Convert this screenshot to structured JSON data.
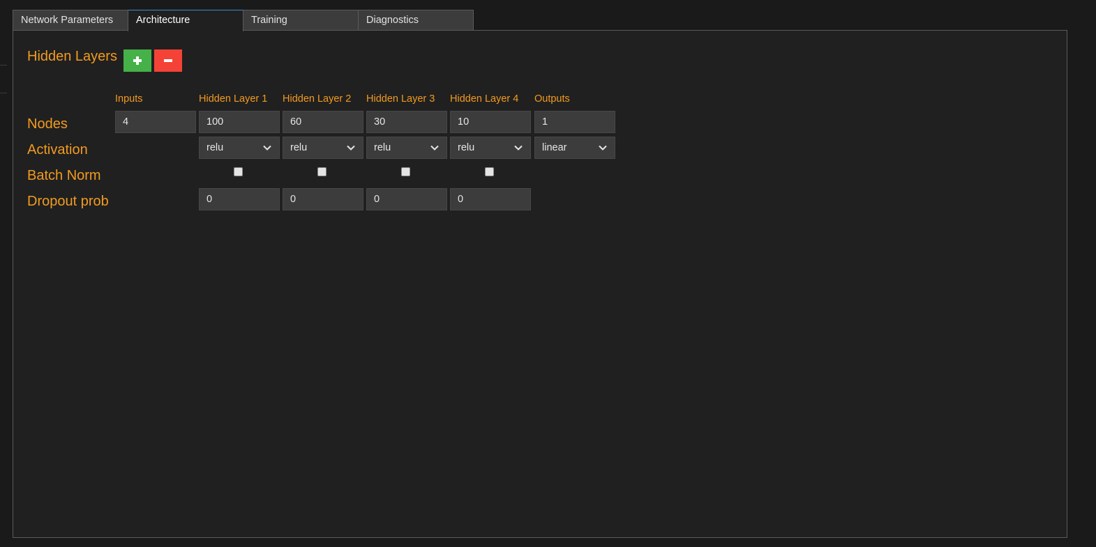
{
  "tabs": [
    {
      "label": "Network Parameters",
      "active": false
    },
    {
      "label": "Architecture",
      "active": true
    },
    {
      "label": "Training",
      "active": false
    },
    {
      "label": "Diagnostics",
      "active": false
    }
  ],
  "architecture": {
    "title": "Hidden Layers",
    "add_icon": "plus-icon",
    "remove_icon": "minus-icon",
    "columns": [
      "Inputs",
      "Hidden Layer 1",
      "Hidden Layer 2",
      "Hidden Layer 3",
      "Hidden Layer 4",
      "Outputs"
    ],
    "rows": {
      "nodes": {
        "label": "Nodes",
        "values": [
          "4",
          "100",
          "60",
          "30",
          "10",
          "1"
        ]
      },
      "activation": {
        "label": "Activation",
        "values": [
          "relu",
          "relu",
          "relu",
          "relu",
          "linear"
        ]
      },
      "batch_norm": {
        "label": "Batch Norm",
        "checked": [
          false,
          false,
          false,
          false
        ]
      },
      "dropout": {
        "label": "Dropout prob",
        "values": [
          "0",
          "0",
          "0",
          "0"
        ]
      }
    }
  },
  "colors": {
    "accent": "#f39b1f",
    "add_button": "#45b148",
    "remove_button": "#f44336",
    "active_tab_border": "#3c8ad2",
    "panel_background": "#202020"
  }
}
